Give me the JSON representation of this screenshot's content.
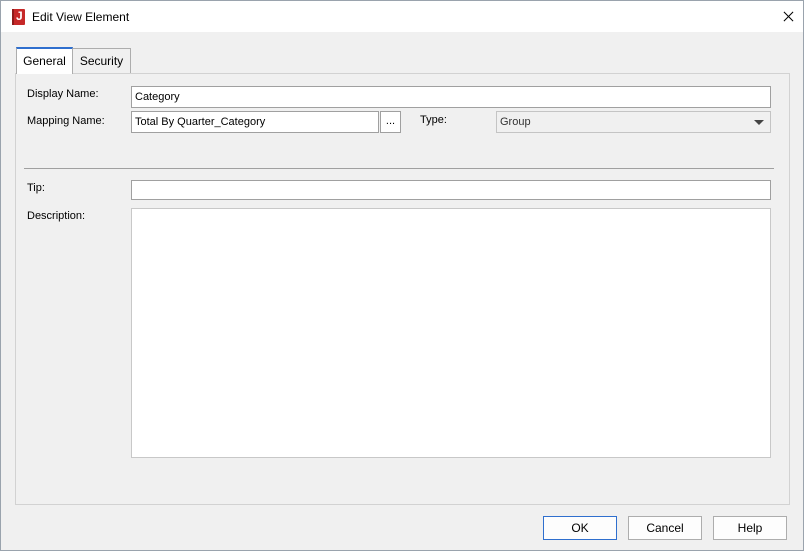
{
  "window": {
    "title": "Edit View Element",
    "app_icon": "jreport-icon",
    "close_icon": "close-icon"
  },
  "tabs": [
    {
      "label": "General",
      "selected": true
    },
    {
      "label": "Security",
      "selected": false
    }
  ],
  "form": {
    "display_name_label": "Display Name:",
    "display_name_value": "Category",
    "mapping_name_label": "Mapping Name:",
    "mapping_name_value": "Total By Quarter_Category",
    "browse_label": "...",
    "type_label": "Type:",
    "type_value": "Group",
    "tip_label": "Tip:",
    "tip_value": "",
    "description_label": "Description:",
    "description_value": ""
  },
  "buttons": {
    "ok": "OK",
    "cancel": "Cancel",
    "help": "Help"
  },
  "colors": {
    "accent": "#2f6fce",
    "app_icon": "#c62828"
  }
}
